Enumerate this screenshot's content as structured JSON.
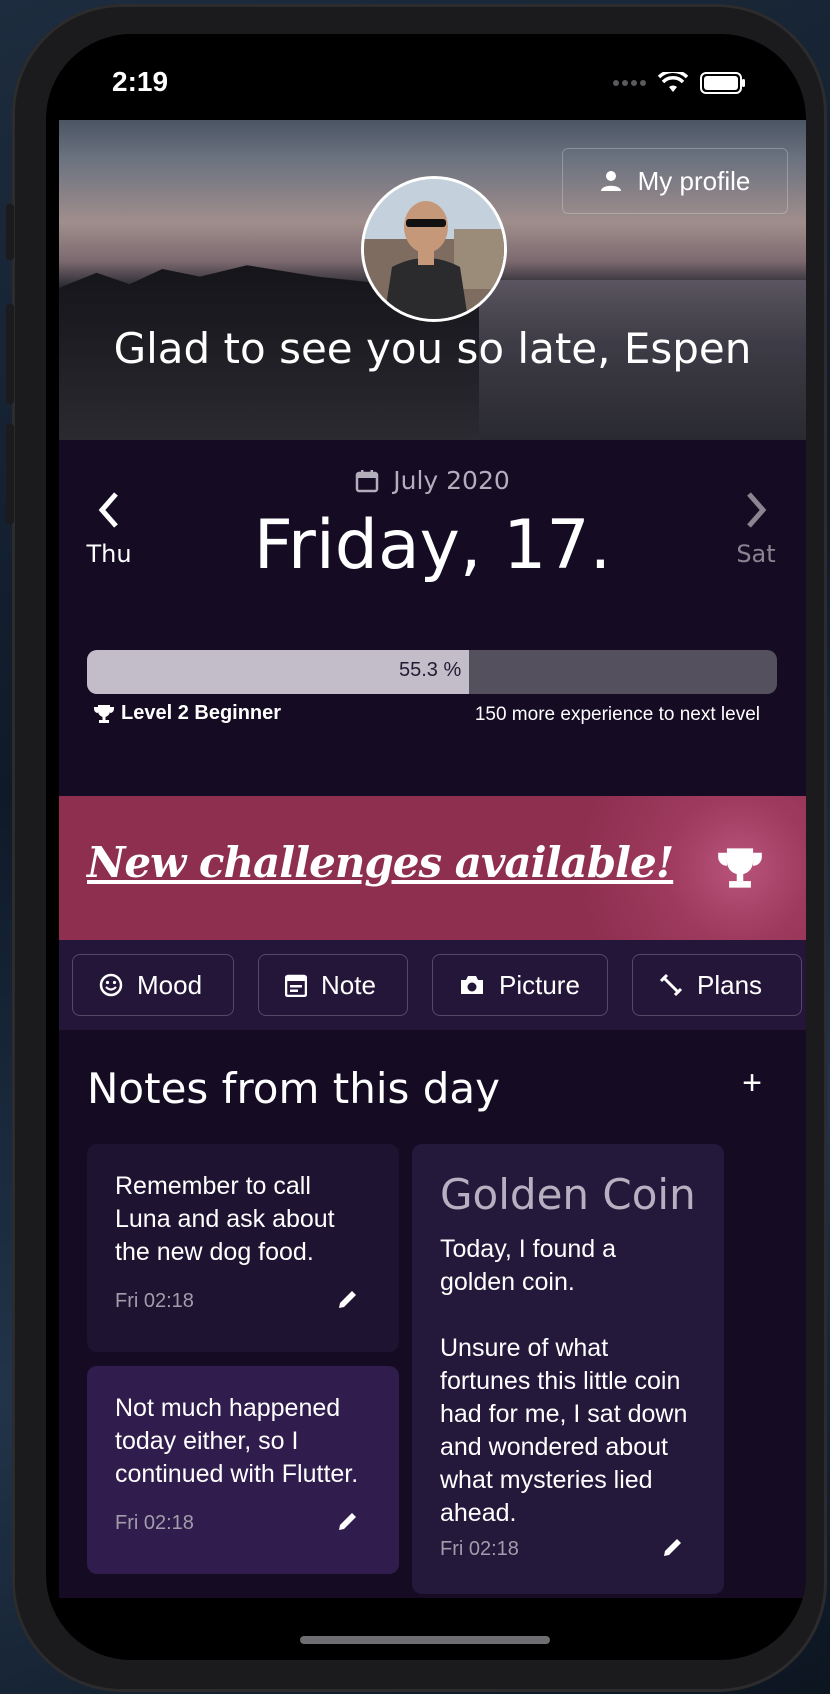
{
  "status_bar": {
    "time": "2:19"
  },
  "header": {
    "profile_button": "My profile",
    "greeting": "Glad to see you so late, Espen"
  },
  "date_nav": {
    "month": "July 2020",
    "day_title": "Friday, 17.",
    "prev_day": "Thu",
    "next_day": "Sat"
  },
  "progress": {
    "percent_label": "55.3 %",
    "fraction": 0.553,
    "level": "Level 2 Beginner",
    "next_level_text": "150 more experience to next level"
  },
  "banner": {
    "text": "New challenges available!"
  },
  "chips": [
    "Mood",
    "Note",
    "Picture",
    "Plans"
  ],
  "notes": {
    "title": "Notes from this day",
    "add_label": "+",
    "cards": [
      {
        "text": "Remember to call\nLuna and ask about\nthe new dog food.",
        "time": "Fri 02:18"
      },
      {
        "text": "Not much happened\ntoday either, so I\ncontinued with Flutter.",
        "time": "Fri 02:18"
      },
      {
        "title": "Golden Coin",
        "text": "Today, I found a\ngolden coin.\n\nUnsure of what\nfortunes this little coin\nhad for me, I sat down\nand wondered about\nwhat mysteries lied\nahead.",
        "time": "Fri 02:18"
      }
    ]
  },
  "colors": {
    "background": "#150c24",
    "banner": "#9e3a5d",
    "chips_bar": "#241639",
    "card_dark": "#1e1330",
    "card_purple": "#301c4d",
    "card_right": "#24183b"
  }
}
